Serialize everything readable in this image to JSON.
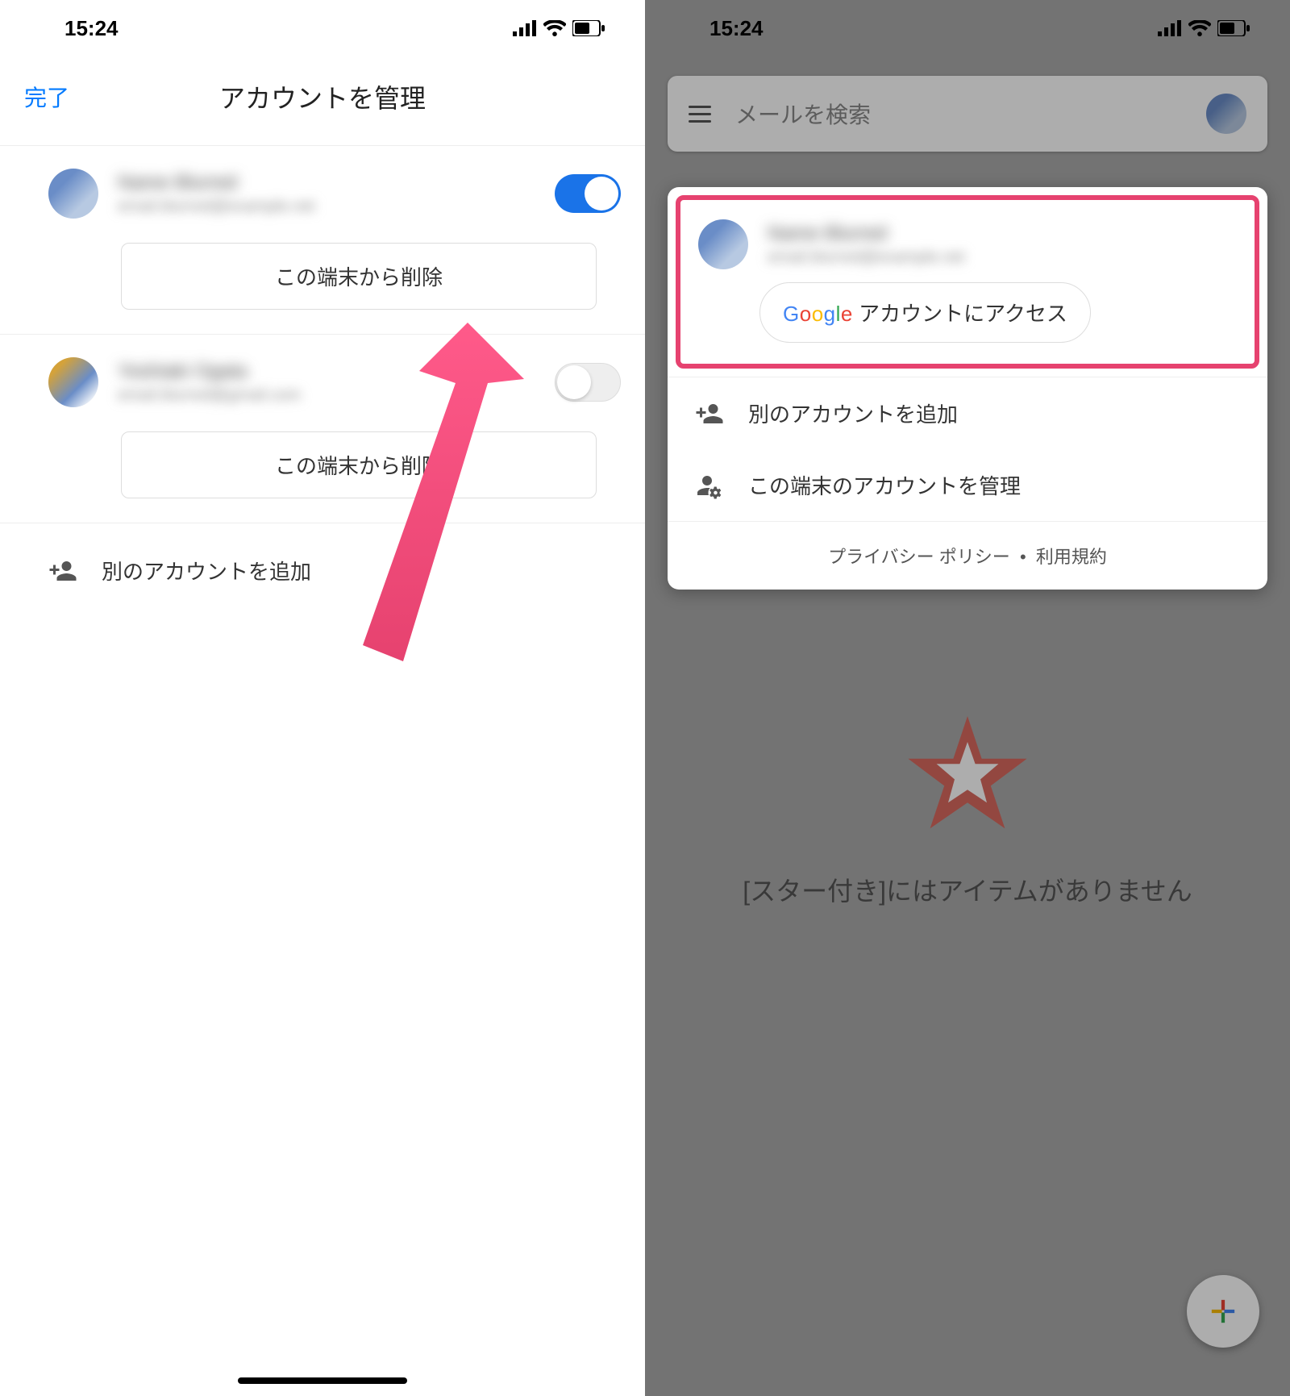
{
  "status": {
    "time": "15:24"
  },
  "left": {
    "done": "完了",
    "title": "アカウントを管理",
    "account1": {
      "remove": "この端末から削除"
    },
    "account2": {
      "remove": "この端末から削除"
    },
    "add": "別のアカウントを追加"
  },
  "right": {
    "search_placeholder": "メールを検索",
    "google_access": "アカウントにアクセス",
    "add": "別のアカウントを追加",
    "manage": "この端末のアカウントを管理",
    "privacy": "プライバシー ポリシー",
    "dot": "•",
    "terms": "利用規約",
    "empty": "[スター付き]にはアイテムがありません"
  }
}
